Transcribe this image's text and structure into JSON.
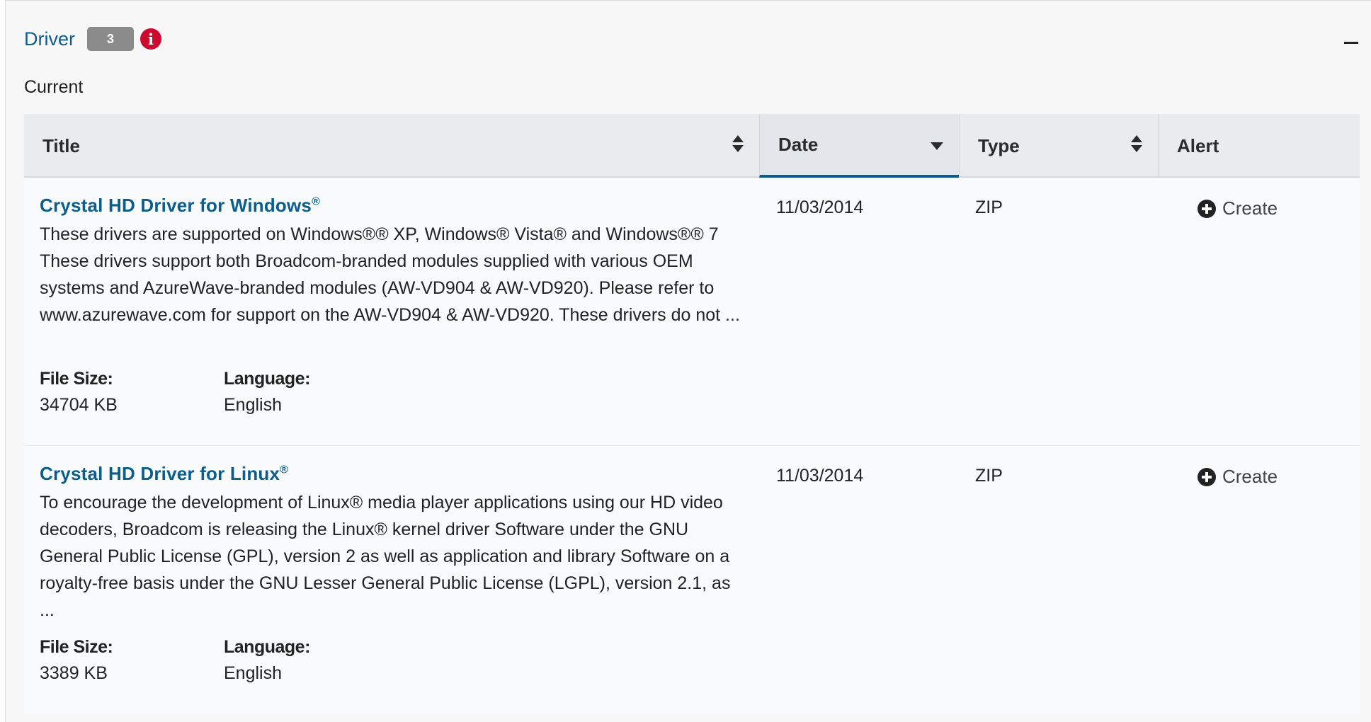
{
  "section": {
    "title": "Driver",
    "count": "3",
    "info_icon": "i",
    "subtitle": "Current"
  },
  "table": {
    "columns": [
      "Title",
      "Date",
      "Type",
      "Alert"
    ],
    "rows": [
      {
        "title": "Crystal HD Driver for Windows",
        "title_mark": "®",
        "description": "These drivers are supported on Windows®® XP, Windows® Vista® and Windows®® 7 These drivers support both Broadcom-branded modules supplied with various OEM systems and AzureWave-branded modules (AW-VD904 & AW-VD920). Please refer to www.azurewave.com for support on the AW-VD904 & AW-VD920. These drivers do not ...",
        "file_size_label": "File Size:",
        "file_size": "34704 KB",
        "language_label": "Language:",
        "language": "English",
        "date": "11/03/2014",
        "type": "ZIP",
        "alert": "Create"
      },
      {
        "title": "Crystal HD Driver for Linux",
        "title_mark": "®",
        "description": "To encourage the development of Linux® media player applications using our HD video decoders, Broadcom is releasing the Linux® kernel driver Software under the GNU General Public License (GPL), version 2 as well as application and library Software on a royalty-free basis under the GNU Lesser General Public License (LGPL), version 2.1, as ...",
        "file_size_label": "File Size:",
        "file_size": "3389 KB",
        "language_label": "Language:",
        "language": "English",
        "date": "11/03/2014",
        "type": "ZIP",
        "alert": "Create"
      }
    ]
  },
  "colors": {
    "link": "#0b5d8c",
    "badge": "#8a8a8a",
    "info": "#cc092f",
    "header_bg": "#e9ebee"
  },
  "icons": [
    "info-icon",
    "collapse-icon",
    "sort-icon",
    "sort-down-icon",
    "plus-circle-icon"
  ]
}
